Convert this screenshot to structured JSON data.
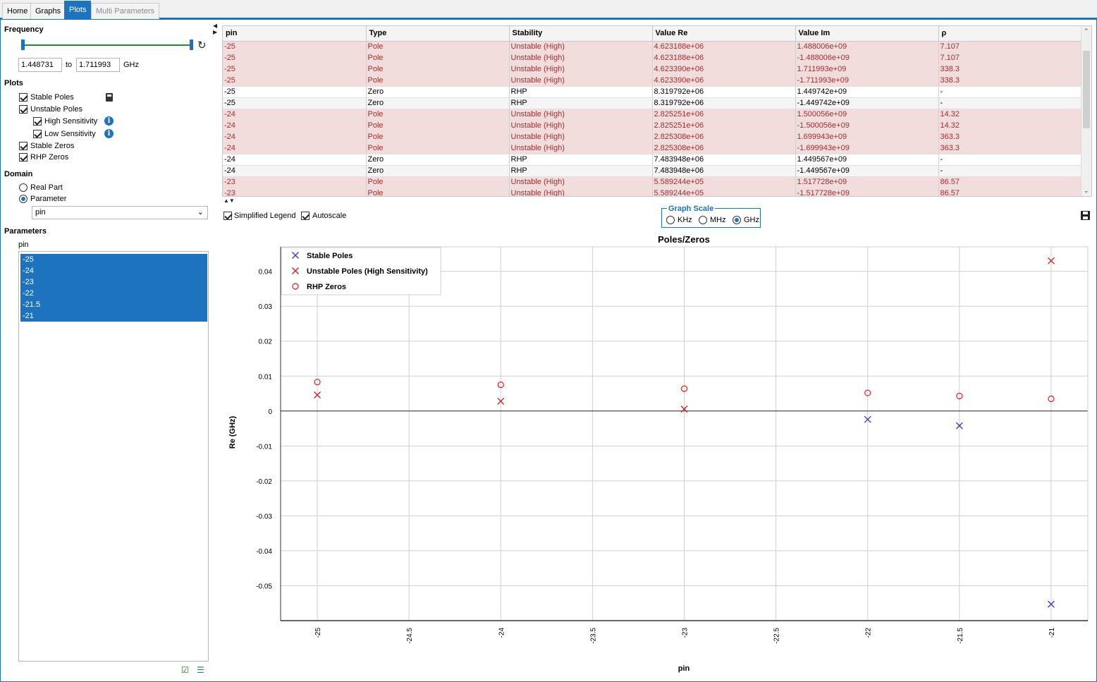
{
  "tabs": [
    {
      "label": "Home",
      "state": "normal"
    },
    {
      "label": "Graphs",
      "state": "normal"
    },
    {
      "label": "Plots",
      "state": "active"
    },
    {
      "label": "Multi Parameters",
      "state": "disabled"
    }
  ],
  "frequency": {
    "title": "Frequency",
    "from": "1.448731",
    "to_label": "to",
    "to": "1.711993",
    "unit": "GHz"
  },
  "plots": {
    "title": "Plots",
    "stable_poles": "Stable Poles",
    "unstable_poles": "Unstable Poles",
    "high_sensitivity": "High Sensitivity",
    "low_sensitivity": "Low Sensitivity",
    "stable_zeros": "Stable Zeros",
    "rhp_zeros": "RHP Zeros"
  },
  "domain": {
    "title": "Domain",
    "real_part": "Real Part",
    "parameter": "Parameter",
    "selected_parameter": "pin"
  },
  "parameters": {
    "title": "Parameters",
    "list_label": "pin",
    "items": [
      "-25",
      "-24",
      "-23",
      "-22",
      "-21.5",
      "-21"
    ]
  },
  "table": {
    "columns": [
      "pin",
      "Type",
      "Stability",
      "Value Re",
      "Value Im",
      "ρ"
    ],
    "rows": [
      {
        "cells": [
          "-25",
          "Pole",
          "Unstable (High)",
          "4.623188e+06",
          "1.488006e+09",
          "7.107"
        ],
        "kind": "unstable"
      },
      {
        "cells": [
          "-25",
          "Pole",
          "Unstable (High)",
          "4.623188e+06",
          "-1.488006e+09",
          "7.107"
        ],
        "kind": "unstable"
      },
      {
        "cells": [
          "-25",
          "Pole",
          "Unstable (High)",
          "4.623390e+06",
          "1.711993e+09",
          "338.3"
        ],
        "kind": "unstable"
      },
      {
        "cells": [
          "-25",
          "Pole",
          "Unstable (High)",
          "4.623390e+06",
          "-1.711993e+09",
          "338.3"
        ],
        "kind": "unstable"
      },
      {
        "cells": [
          "-25",
          "Zero",
          "RHP",
          "8.319792e+06",
          "1.449742e+09",
          "-"
        ],
        "kind": "rhp"
      },
      {
        "cells": [
          "-25",
          "Zero",
          "RHP",
          "8.319792e+06",
          "-1.449742e+09",
          "-"
        ],
        "kind": "rhp"
      },
      {
        "cells": [
          "-24",
          "Pole",
          "Unstable (High)",
          "2.825251e+06",
          "1.500056e+09",
          "14.32"
        ],
        "kind": "unstable"
      },
      {
        "cells": [
          "-24",
          "Pole",
          "Unstable (High)",
          "2.825251e+06",
          "-1.500056e+09",
          "14.32"
        ],
        "kind": "unstable"
      },
      {
        "cells": [
          "-24",
          "Pole",
          "Unstable (High)",
          "2.825308e+06",
          "1.699943e+09",
          "363.3"
        ],
        "kind": "unstable"
      },
      {
        "cells": [
          "-24",
          "Pole",
          "Unstable (High)",
          "2.825308e+06",
          "-1.699943e+09",
          "363.3"
        ],
        "kind": "unstable"
      },
      {
        "cells": [
          "-24",
          "Zero",
          "RHP",
          "7.483948e+06",
          "1.449567e+09",
          "-"
        ],
        "kind": "rhp"
      },
      {
        "cells": [
          "-24",
          "Zero",
          "RHP",
          "7.483948e+06",
          "-1.449567e+09",
          "-"
        ],
        "kind": "rhp"
      },
      {
        "cells": [
          "-23",
          "Pole",
          "Unstable (High)",
          "5.589244e+05",
          "1.517728e+09",
          "86.57"
        ],
        "kind": "unstable"
      },
      {
        "cells": [
          "-23",
          "Pole",
          "Unstable (High)",
          "5.589244e+05",
          "-1.517728e+09",
          "86.57"
        ],
        "kind": "unstable"
      }
    ]
  },
  "graph_controls": {
    "simplified_legend": "Simplified Legend",
    "autoscale": "Autoscale",
    "graph_scale_title": "Graph Scale",
    "khz": "KHz",
    "mhz": "MHz",
    "ghz": "GHz",
    "selected_scale": "GHz"
  },
  "colors": {
    "accent": "#1e73be",
    "stable_pole": "#3a3ae0",
    "unstable_pole": "#c0282c",
    "rhp_zero": "#e02020",
    "unstable_row_bg": "#f2dcdc",
    "unstable_row_text": "#a03030"
  },
  "icons": {
    "calculator": "calculator-icon",
    "info": "info-icon",
    "reset": "reset-icon",
    "save": "save-icon",
    "check_all": "check-all-icon",
    "uncheck_all": "uncheck-all-icon"
  },
  "chart_data": {
    "type": "scatter",
    "title": "Poles/Zeros",
    "xlabel": "pin",
    "ylabel": "Re (GHz)",
    "xlim": [
      -25.2,
      -20.8
    ],
    "ylim": [
      -0.06,
      0.047
    ],
    "x_ticks": [
      -25,
      -24.5,
      -24,
      -23.5,
      -23,
      -22.5,
      -22,
      -21.5,
      -21
    ],
    "x_tick_labels": [
      "-25",
      "-24.5",
      "-24",
      "-23.5",
      "-23",
      "-22.5",
      "-22",
      "-21.5",
      "-21"
    ],
    "y_ticks": [
      0.04,
      0.03,
      0.02,
      0.01,
      0,
      -0.01,
      -0.02,
      -0.03,
      -0.04,
      -0.05
    ],
    "y_tick_labels": [
      "0.04",
      "0.03",
      "0.02",
      "0.01",
      "0",
      "-0.01",
      "-0.02",
      "-0.03",
      "-0.04",
      "-0.05"
    ],
    "grid": true,
    "legend_position": "top-left",
    "series": [
      {
        "name": "Stable Poles",
        "marker": "x",
        "color": "#3a3ae0",
        "points": [
          [
            -22,
            -0.0024
          ],
          [
            -21.5,
            -0.0042
          ],
          [
            -21,
            -0.0553
          ]
        ]
      },
      {
        "name": "Unstable Poles (High Sensitivity)",
        "marker": "x",
        "color": "#c0282c",
        "points": [
          [
            -25,
            0.0046
          ],
          [
            -24,
            0.0028
          ],
          [
            -23,
            0.00056
          ],
          [
            -21,
            0.043
          ]
        ]
      },
      {
        "name": "RHP Zeros",
        "marker": "o",
        "color": "#e02020",
        "points": [
          [
            -25,
            0.0083
          ],
          [
            -24,
            0.0075
          ],
          [
            -23,
            0.0064
          ],
          [
            -22,
            0.0052
          ],
          [
            -21.5,
            0.0043
          ],
          [
            -21,
            0.0035
          ]
        ]
      }
    ]
  }
}
